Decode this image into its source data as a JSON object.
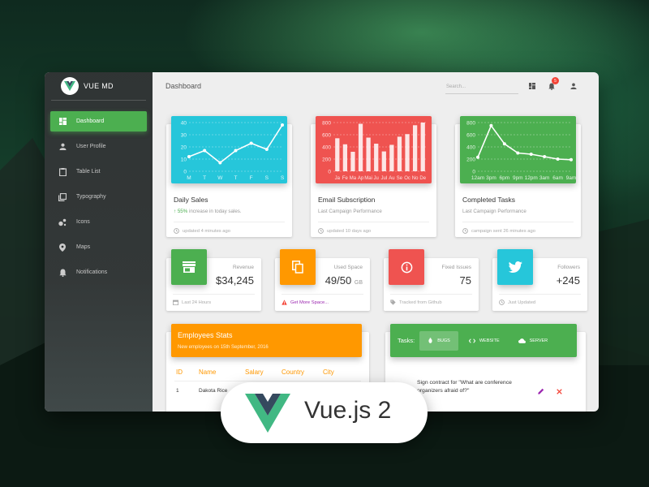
{
  "brand": {
    "name": "VUE MD"
  },
  "sidebar": {
    "items": [
      {
        "label": "Dashboard",
        "icon": "dashboard-icon",
        "active": true
      },
      {
        "label": "User Profile",
        "icon": "person-icon"
      },
      {
        "label": "Table List",
        "icon": "clipboard-icon"
      },
      {
        "label": "Typography",
        "icon": "library-books-icon"
      },
      {
        "label": "Icons",
        "icon": "bubble-chart-icon"
      },
      {
        "label": "Maps",
        "icon": "place-icon"
      },
      {
        "label": "Notifications",
        "icon": "bell-icon"
      }
    ]
  },
  "header": {
    "title": "Dashboard",
    "search_placeholder": "Search...",
    "notification_count": "5"
  },
  "cards": {
    "daily_sales": {
      "title": "Daily Sales",
      "sub_value": "55%",
      "sub_text": " increase in today sales.",
      "footer": "updated 4 minutes ago",
      "color": "#26c6da"
    },
    "email_subscription": {
      "title": "Email Subscription",
      "sub_text": "Last Campaign Performance",
      "footer": "updated 10 days ago",
      "color": "#ef5350"
    },
    "completed_tasks": {
      "title": "Completed Tasks",
      "sub_text": "Last Campaign Performance",
      "footer": "campaign sent 26 minutes ago",
      "color": "#4caf50"
    }
  },
  "chart_data": [
    {
      "type": "line",
      "categories": [
        "M",
        "T",
        "W",
        "T",
        "F",
        "S",
        "S"
      ],
      "values": [
        12,
        17,
        7,
        17,
        23,
        18,
        38
      ],
      "ylim": [
        0,
        40
      ],
      "yticks": [
        0,
        10,
        20,
        30,
        40
      ]
    },
    {
      "type": "bar",
      "categories": [
        "Ja",
        "Fe",
        "Ma",
        "Ap",
        "Mai",
        "Ju",
        "Jul",
        "Au",
        "Se",
        "Oc",
        "No",
        "De"
      ],
      "values": [
        542,
        443,
        320,
        780,
        553,
        453,
        326,
        434,
        568,
        610,
        756,
        895
      ],
      "ylim": [
        0,
        800
      ],
      "yticks": [
        0,
        200,
        400,
        600,
        800
      ]
    },
    {
      "type": "line",
      "categories": [
        "12am",
        "3pm",
        "6pm",
        "9pm",
        "12pm",
        "3am",
        "6am",
        "9am"
      ],
      "values": [
        230,
        750,
        450,
        300,
        280,
        240,
        200,
        190
      ],
      "ylim": [
        0,
        800
      ],
      "yticks": [
        0,
        200,
        400,
        600,
        800
      ]
    }
  ],
  "stats": [
    {
      "label": "Revenue",
      "value": "$34,245",
      "unit": "",
      "footer": "Last 24 Hours",
      "icon": "store-icon",
      "color": "#4caf50"
    },
    {
      "label": "Used Space",
      "value": "49/50",
      "unit": "GB",
      "footer": "Get More Space...",
      "icon": "content-copy-icon",
      "color": "#ff9800"
    },
    {
      "label": "Fixed Issues",
      "value": "75",
      "unit": "",
      "footer": "Tracked from Github",
      "icon": "info-icon",
      "color": "#ef5350"
    },
    {
      "label": "Followers",
      "value": "+245",
      "unit": "",
      "footer": "Just Updated",
      "icon": "twitter-icon",
      "color": "#26c6da"
    }
  ],
  "employees": {
    "title": "Employees Stats",
    "subtitle": "New employees on 15th September, 2016",
    "columns": [
      "ID",
      "Name",
      "Salary",
      "Country",
      "City"
    ],
    "rows": [
      {
        "id": "1",
        "name": "Dakota Rice"
      }
    ]
  },
  "tasks": {
    "label": "Tasks:",
    "tabs": [
      {
        "label": "BUGS",
        "icon": "bug-icon",
        "active": true
      },
      {
        "label": "WEBSITE",
        "icon": "code-icon"
      },
      {
        "label": "SERVER",
        "icon": "cloud-icon"
      }
    ],
    "items": [
      {
        "text": "Sign contract for \"What are conference organizers afraid of?\""
      }
    ]
  },
  "banner": {
    "text": "Vue.js 2"
  }
}
